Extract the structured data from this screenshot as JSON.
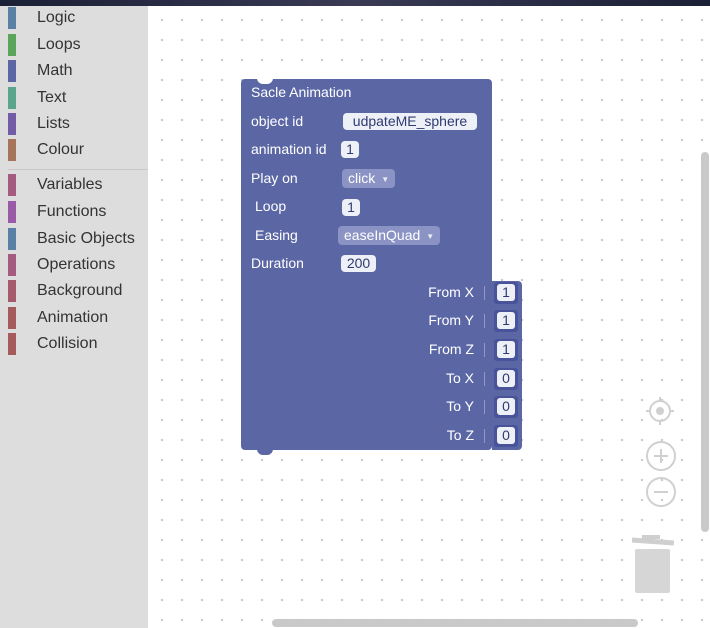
{
  "toolbox": {
    "categories": [
      {
        "label": "Logic",
        "color": "#5b80a5"
      },
      {
        "label": "Loops",
        "color": "#5ba55b"
      },
      {
        "label": "Math",
        "color": "#5b67a5"
      },
      {
        "label": "Text",
        "color": "#5ba58c"
      },
      {
        "label": "Lists",
        "color": "#745ba5"
      },
      {
        "label": "Colour",
        "color": "#a5745b"
      },
      {
        "label": "Variables",
        "color": "#a55b80"
      },
      {
        "label": "Functions",
        "color": "#995ba5"
      },
      {
        "label": "Basic Objects",
        "color": "#5b80a5"
      },
      {
        "label": "Operations",
        "color": "#a55b80"
      },
      {
        "label": "Background",
        "color": "#a55b6b"
      },
      {
        "label": "Animation",
        "color": "#a55b5b"
      },
      {
        "label": "Collision",
        "color": "#a55b5b"
      }
    ]
  },
  "block": {
    "title": "Sacle Animation",
    "color": "#5b67a5",
    "object_id_label": "object id",
    "object_id_value": "udpateME_sphere",
    "animation_id_label": "animation id",
    "animation_id_value": "1",
    "play_on_label": "Play on",
    "play_on_value": "click",
    "loop_label": "Loop",
    "loop_value": "1",
    "easing_label": "Easing",
    "easing_value": "easeInQuad",
    "duration_label": "Duration",
    "duration_value": "200",
    "inputs": [
      {
        "label": "From X",
        "value": "1"
      },
      {
        "label": "From Y",
        "value": "1"
      },
      {
        "label": "From Z",
        "value": "1"
      },
      {
        "label": "To X",
        "value": "0"
      },
      {
        "label": "To Y",
        "value": "0"
      },
      {
        "label": "To Z",
        "value": "0"
      }
    ]
  },
  "controls": {
    "icons": [
      "target-icon",
      "zoom-in-icon",
      "zoom-out-icon",
      "trash-icon"
    ]
  }
}
